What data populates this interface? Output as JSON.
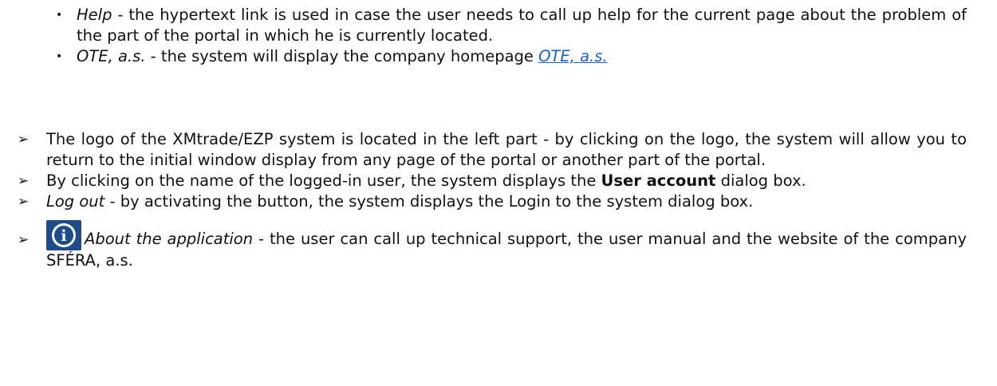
{
  "bullets": [
    {
      "term": "Help",
      "text": " - the hypertext link is used in case the user needs to call up help for the current page about the problem of the part of the portal in which he is currently located."
    },
    {
      "term": "OTE, a.s.",
      "text": " - the system will display the company homepage ",
      "link": "OTE, a.s."
    }
  ],
  "items": [
    {
      "text": "The logo of the XMtrade/EZP system is located in the left part - by clicking on the logo, the system will allow you to return to the initial window display from any page of the portal or another part of the portal."
    },
    {
      "pre": "By clicking on the name of the logged-in user, the system displays the ",
      "bold": "User account",
      "post": " dialog box."
    },
    {
      "term": "Log out",
      "text": " - by activating the button, the system displays the Login to the system dialog box."
    },
    {
      "term": "About the application",
      "text": " - the user can call up technical support, the user manual and the website of the company SFÉRA, a.s."
    }
  ],
  "glyphs": {
    "bullet": "•",
    "arrow": "➢",
    "info_icon_letter": "i"
  },
  "colors": {
    "link": "#1a5fd0",
    "icon_bg": "#1e4c8a"
  }
}
